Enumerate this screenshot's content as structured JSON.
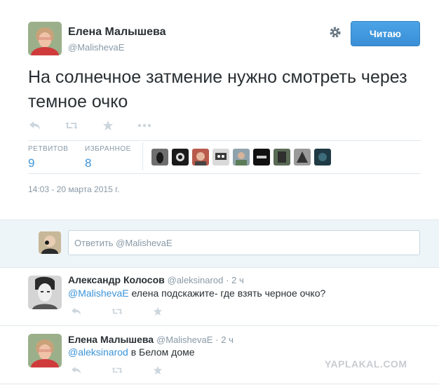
{
  "tweet": {
    "author_name": "Елена Малышева",
    "author_handle": "@MalishevaE",
    "follow_label": "Читаю",
    "text": "На солнечное затмение нужно смотреть через темное очко",
    "stats": {
      "retweets_label": "РЕТВИТОВ",
      "retweets": "9",
      "favorites_label": "ИЗБРАННОЕ",
      "favorites": "8"
    },
    "timestamp": "14:03 - 20 марта 2015 г."
  },
  "reply_box": {
    "placeholder": "Ответить @MalishevaE"
  },
  "replies": [
    {
      "name": "Александр Колосов",
      "handle": "@aleksinarod",
      "time": "· 2 ч",
      "mention": "@MalishevaE",
      "text": " елена подскажите- где взять черное очко?"
    },
    {
      "name": "Елена Малышева",
      "handle": "@MalishevaE",
      "time": "· 2 ч",
      "mention": "@aleksinarod",
      "text": " в Белом доме"
    }
  ],
  "watermark": "YAPLAKAL.COM",
  "colors": {
    "accent": "#3b94d9",
    "muted": "#8899a6",
    "text": "#292f33"
  }
}
